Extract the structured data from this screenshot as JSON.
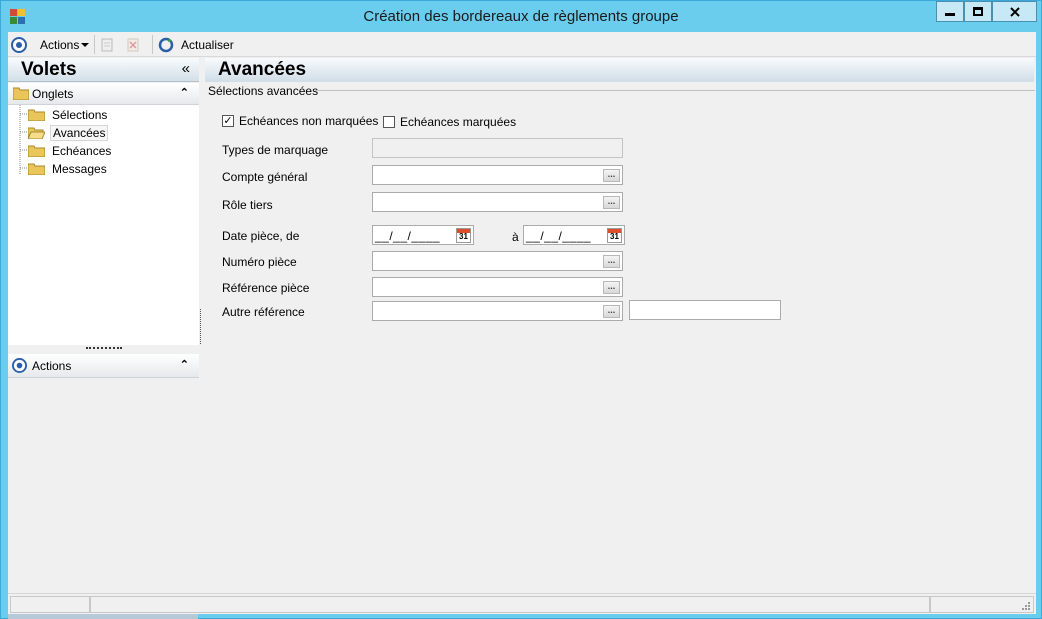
{
  "window": {
    "title": "Création des bordereaux de règlements groupe"
  },
  "toolbar": {
    "actions_label": "Actions",
    "refresh_label": "Actualiser"
  },
  "left_pane": {
    "title": "Volets",
    "collapse_glyph": "«",
    "tabs_group": {
      "label": "Onglets",
      "items": [
        {
          "label": "Sélections",
          "selected": false
        },
        {
          "label": "Avancées",
          "selected": true
        },
        {
          "label": "Echéances",
          "selected": false
        },
        {
          "label": "Messages",
          "selected": false
        }
      ]
    },
    "actions_group": {
      "label": "Actions"
    }
  },
  "main": {
    "title": "Avancées",
    "section_title": "Sélections avancées",
    "checkboxes": [
      {
        "label": "Echéances non marquées",
        "checked": true
      },
      {
        "label": "Echéances marquées",
        "checked": false
      }
    ],
    "fields": {
      "types_marquage": {
        "label": "Types de marquage",
        "value": ""
      },
      "compte_general": {
        "label": "Compte général",
        "value": ""
      },
      "role_tiers": {
        "label": "Rôle tiers",
        "value": ""
      },
      "date_piece": {
        "label": "Date pièce, de",
        "from": "__/__/____",
        "to_label": "à",
        "to": "__/__/____"
      },
      "numero_piece": {
        "label": "Numéro pièce",
        "value": ""
      },
      "reference_piece": {
        "label": "Référence pièce",
        "value": ""
      },
      "autre_reference": {
        "label": "Autre référence",
        "value": "",
        "extra_value": ""
      }
    },
    "ellipsis": "...",
    "calendar_day": "31"
  }
}
